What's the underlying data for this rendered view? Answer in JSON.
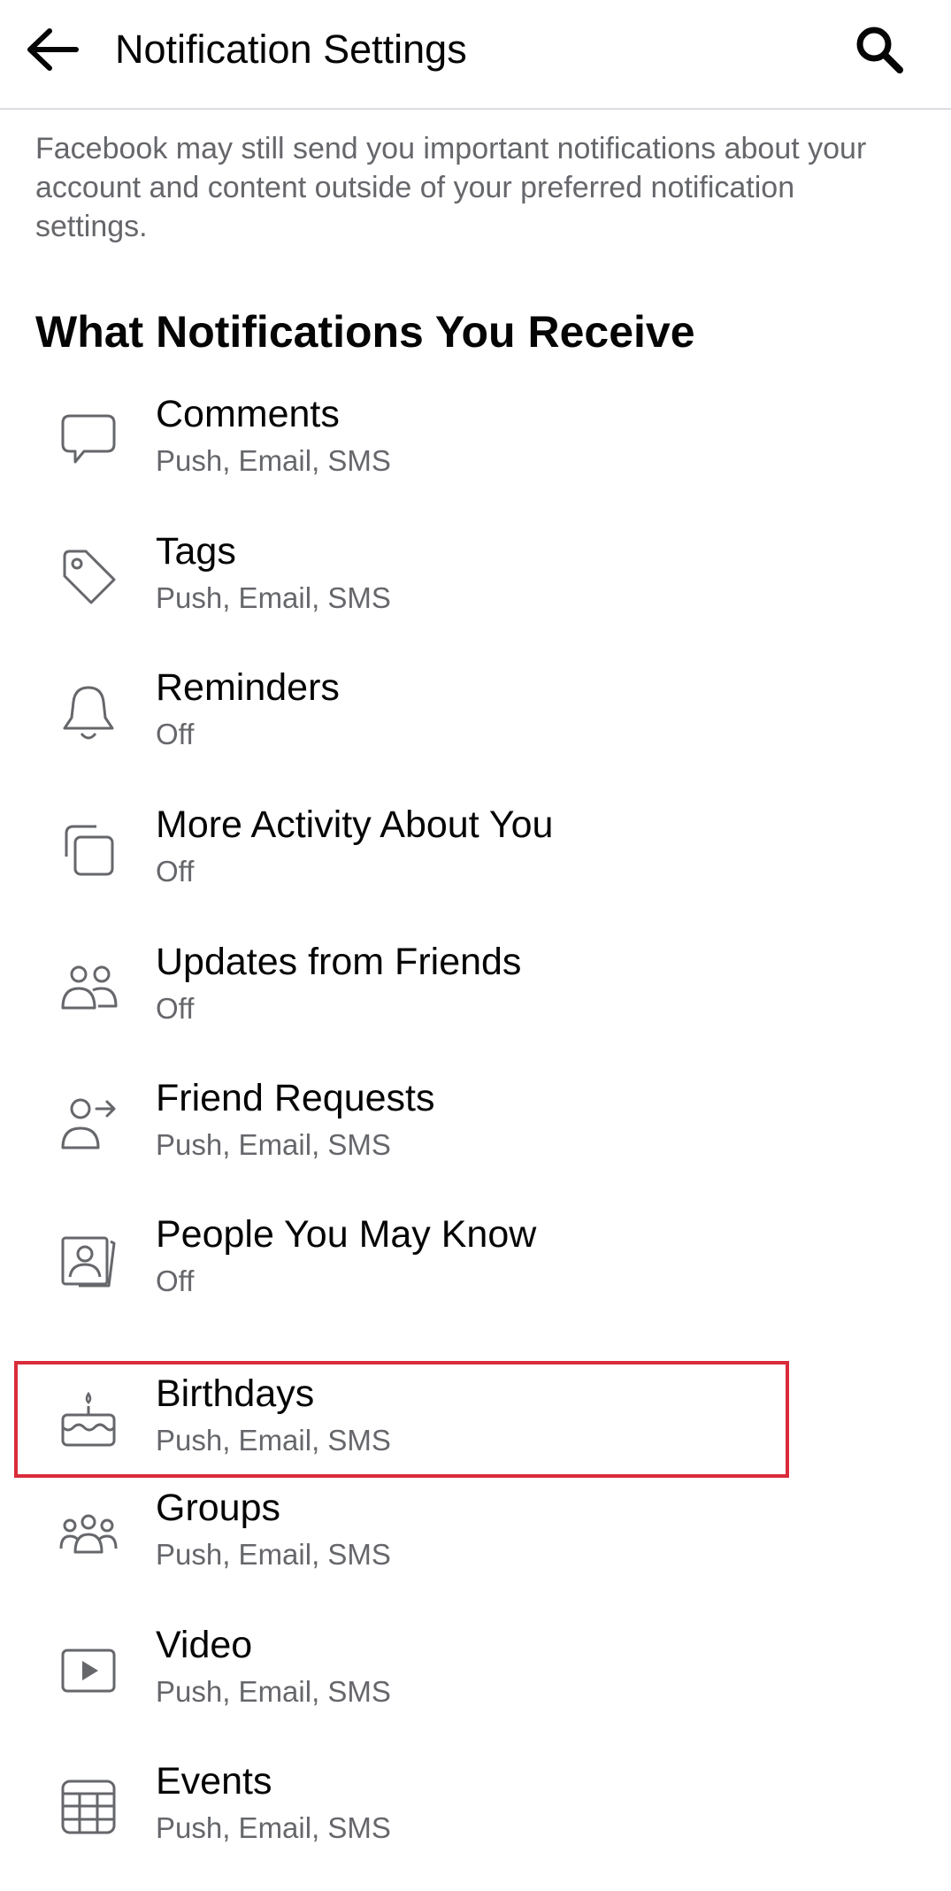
{
  "header": {
    "title": "Notification Settings",
    "back_icon": "arrow-left-icon",
    "search_icon": "search-icon"
  },
  "disclaimer": "Facebook may still send you important notifications about your account and content outside of your preferred notification settings.",
  "section": {
    "heading": "What Notifications You Receive"
  },
  "items": [
    {
      "title": "Comments",
      "subtitle": "Push, Email, SMS",
      "icon": "comment-icon"
    },
    {
      "title": "Tags",
      "subtitle": "Push, Email, SMS",
      "icon": "tag-icon"
    },
    {
      "title": "Reminders",
      "subtitle": "Off",
      "icon": "bell-icon"
    },
    {
      "title": "More Activity About You",
      "subtitle": "Off",
      "icon": "stacked-squares-icon"
    },
    {
      "title": "Updates from Friends",
      "subtitle": "Off",
      "icon": "friends-icon"
    },
    {
      "title": "Friend Requests",
      "subtitle": "Push, Email, SMS",
      "icon": "person-arrow-icon"
    },
    {
      "title": "People You May Know",
      "subtitle": "Off",
      "icon": "portrait-icon"
    },
    {
      "title": "Birthdays",
      "subtitle": "Push, Email, SMS",
      "icon": "cake-icon",
      "highlighted": true
    },
    {
      "title": "Groups",
      "subtitle": "Push, Email, SMS",
      "icon": "group-icon"
    },
    {
      "title": "Video",
      "subtitle": "Push, Email, SMS",
      "icon": "play-icon"
    },
    {
      "title": "Events",
      "subtitle": "Push, Email, SMS",
      "icon": "calendar-icon"
    }
  ],
  "colors": {
    "primary_text": "#050505",
    "secondary_text": "#65676b",
    "divider": "#dadde1",
    "highlight_border": "#d92b3a"
  }
}
